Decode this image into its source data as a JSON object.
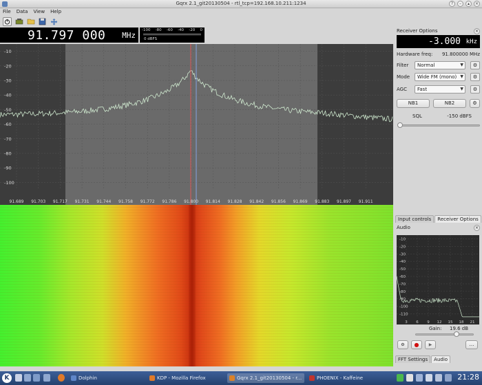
{
  "window": {
    "title": "Gqrx 2.1_git20130504 - rtl_tcp=192.168.10.211:1234"
  },
  "menu": [
    "File",
    "Data",
    "View",
    "Help"
  ],
  "frequency": {
    "value": "91.797 000",
    "unit": "MHz"
  },
  "signal_meter": {
    "scale": [
      "-100",
      "-80",
      "-60",
      "-40",
      "-20",
      "0"
    ],
    "unit": "dBFS"
  },
  "spectrum": {
    "y_ticks": [
      "-10",
      "-20",
      "-30",
      "-40",
      "-50",
      "-60",
      "-70",
      "-80",
      "-90",
      "-100"
    ],
    "x_ticks": [
      "91.689",
      "91.703",
      "91.717",
      "91.731",
      "91.744",
      "91.758",
      "91.772",
      "91.786",
      "91.800",
      "91.814",
      "91.828",
      "91.842",
      "91.856",
      "91.869",
      "91.883",
      "91.897",
      "91.911"
    ]
  },
  "receiver": {
    "panel_title": "Receiver Options",
    "offset": {
      "value": "-3.000",
      "unit": "kHz"
    },
    "hardware_freq_label": "Hardware freq:",
    "hardware_freq": "91.800000 MHz",
    "filter": {
      "label": "Filter",
      "value": "Normal"
    },
    "mode": {
      "label": "Mode",
      "value": "Wide FM (mono)"
    },
    "agc": {
      "label": "AGC",
      "value": "Fast"
    },
    "nb1": "NB1",
    "nb2": "NB2",
    "sql": {
      "label": "SQL",
      "value": "-150 dBFS"
    },
    "tabs": [
      "Input controls",
      "Receiver Options"
    ]
  },
  "audio": {
    "panel_title": "Audio",
    "y_ticks": [
      "-10",
      "-20",
      "-30",
      "-40",
      "-50",
      "-60",
      "-70",
      "-80",
      "-90",
      "-100",
      "-110"
    ],
    "x_ticks": [
      "3",
      "6",
      "9",
      "12",
      "15",
      "18",
      "21"
    ],
    "gain_label": "Gain:",
    "gain_value": "19.6 dB",
    "tabs": [
      "FFT Settings",
      "Audio"
    ]
  },
  "taskbar": {
    "tasks": [
      "Dolphin",
      "KDP - Mozilla Firefox",
      "Gqrx 2.1_git20130504 - r...",
      "PHOENIX - Kaffeine"
    ],
    "clock": "21:28"
  }
}
